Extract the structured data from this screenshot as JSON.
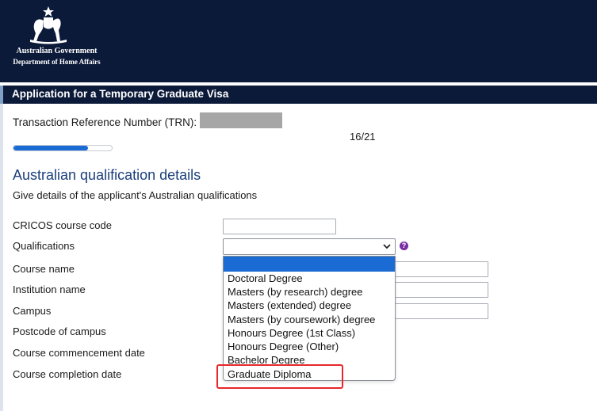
{
  "header": {
    "agency_line1": "Australian Government",
    "agency_line2": "Department of Home Affairs",
    "logo": "coat-of-arms-icon"
  },
  "page": {
    "title": "Application for a Temporary Graduate Visa",
    "trn_label": "Transaction Reference Number (TRN):",
    "page_counter": "16/21",
    "progress_fraction": 0.76
  },
  "section": {
    "title": "Australian qualification details",
    "description": "Give details of the applicant's Australian qualifications"
  },
  "fields": {
    "cricos": {
      "label": "CRICOS course code",
      "value": ""
    },
    "qualifications": {
      "label": "Qualifications",
      "value": ""
    },
    "course_name": {
      "label": "Course name",
      "value": ""
    },
    "institution_name": {
      "label": "Institution name",
      "value": ""
    },
    "campus": {
      "label": "Campus",
      "value": ""
    },
    "postcode": {
      "label": "Postcode of campus"
    },
    "commencement": {
      "label": "Course commencement date"
    },
    "completion": {
      "label": "Course completion date"
    }
  },
  "qualification_options": [
    "",
    "Doctoral Degree",
    "Masters (by research) degree",
    "Masters (extended) degree",
    "Masters (by coursework) degree",
    "Honours Degree (1st Class)",
    "Honours Degree (Other)",
    "Bachelor Degree",
    "Graduate Diploma"
  ],
  "help_glyph": "?",
  "colors": {
    "header_bg": "#0c1a3a",
    "accent": "#1a6cd4",
    "section_title": "#1a3f7a",
    "highlight": "#e8262b",
    "help_icon": "#7a2ca3"
  }
}
